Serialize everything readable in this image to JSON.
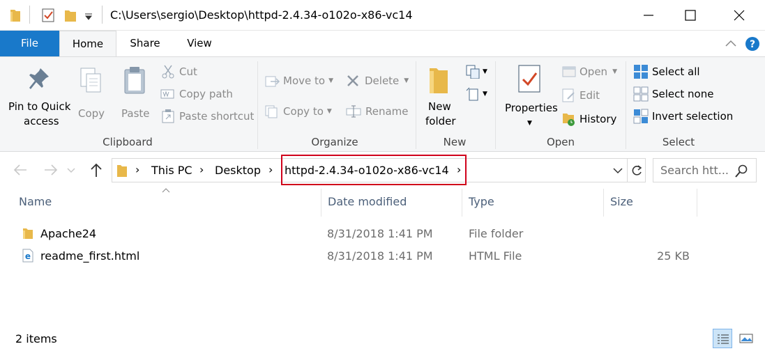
{
  "titlebar": {
    "path": "C:\\Users\\sergio\\Desktop\\httpd-2.4.34-o102o-x86-vc14"
  },
  "tabs": [
    {
      "label": "File"
    },
    {
      "label": "Home"
    },
    {
      "label": "Share"
    },
    {
      "label": "View"
    }
  ],
  "ribbon": {
    "clipboard": {
      "pin_label_1": "Pin to Quick",
      "pin_label_2": "access",
      "copy": "Copy",
      "paste": "Paste",
      "cut": "Cut",
      "copy_path": "Copy path",
      "paste_shortcut": "Paste shortcut",
      "group": "Clipboard"
    },
    "organize": {
      "move_to": "Move to",
      "copy_to": "Copy to",
      "delete": "Delete",
      "rename": "Rename",
      "group": "Organize"
    },
    "new": {
      "new_folder_1": "New",
      "new_folder_2": "folder",
      "group": "New"
    },
    "open": {
      "properties": "Properties",
      "open": "Open",
      "edit": "Edit",
      "history": "History",
      "group": "Open"
    },
    "select": {
      "select_all": "Select all",
      "select_none": "Select none",
      "invert": "Invert selection",
      "group": "Select"
    }
  },
  "address": {
    "crumbs": [
      "This PC",
      "Desktop",
      "httpd-2.4.34-o102o-x86-vc14"
    ],
    "search_placeholder": "Search htt..."
  },
  "columns": {
    "name": "Name",
    "date": "Date modified",
    "type": "Type",
    "size": "Size"
  },
  "files": [
    {
      "name": "Apache24",
      "date": "8/31/2018 1:41 PM",
      "type": "File folder",
      "size": ""
    },
    {
      "name": "readme_first.html",
      "date": "8/31/2018 1:41 PM",
      "type": "HTML File",
      "size": "25 KB"
    }
  ],
  "status": {
    "items": "2 items"
  },
  "colors": {
    "file_tab": "#1979ca",
    "highlight_box": "#d0021b",
    "folder_yellow": "#e8b84a"
  }
}
